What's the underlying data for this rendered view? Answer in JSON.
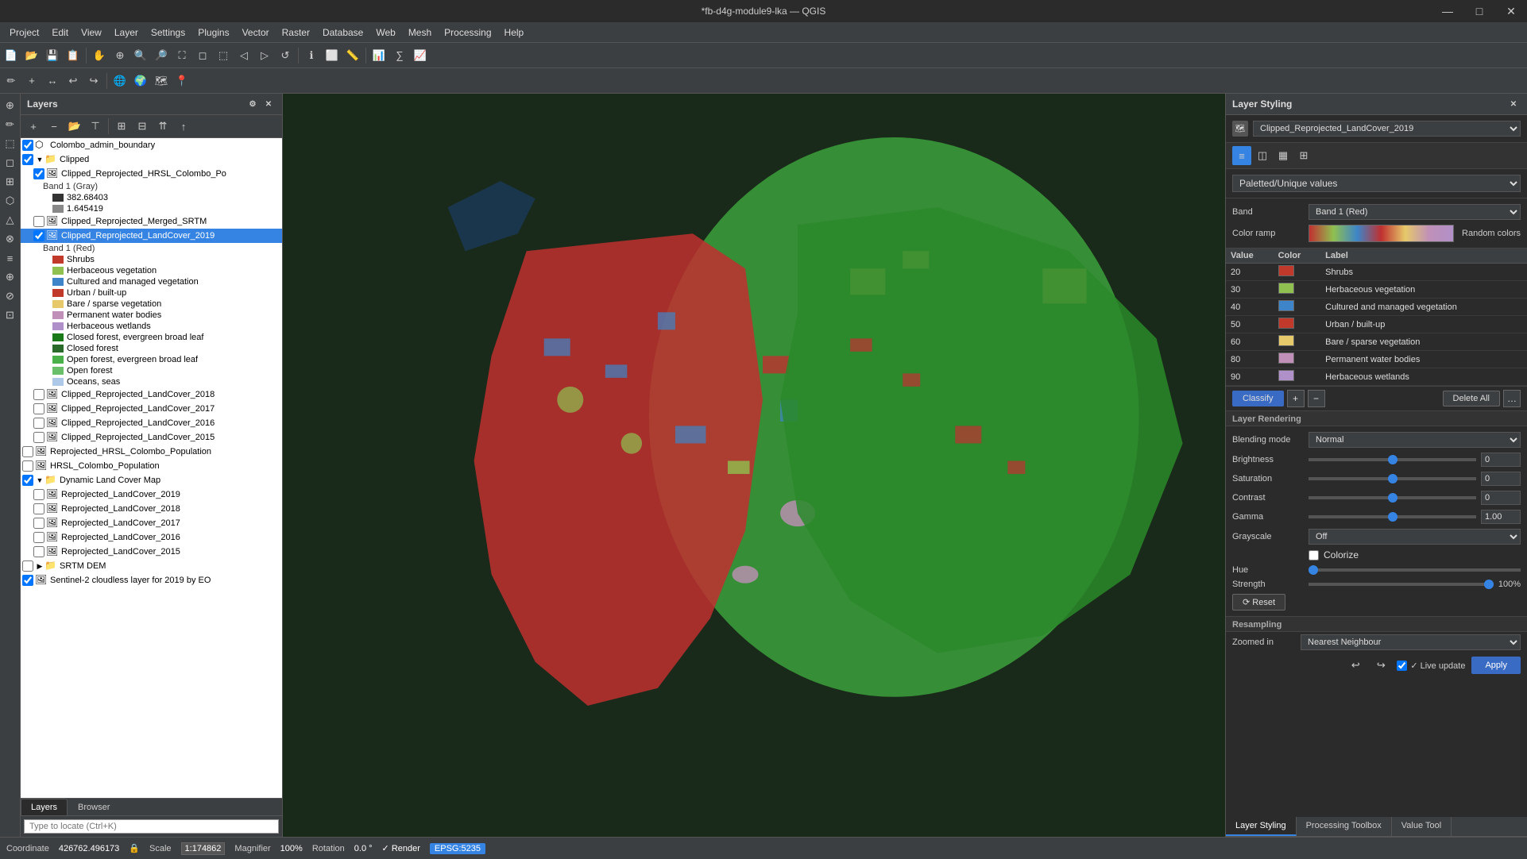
{
  "titlebar": {
    "title": "*fb-d4g-module9-lka — QGIS",
    "minimize": "—",
    "maximize": "□",
    "close": "✕"
  },
  "menubar": {
    "items": [
      "Project",
      "Edit",
      "View",
      "Layer",
      "Settings",
      "Plugins",
      "Vector",
      "Raster",
      "Database",
      "Web",
      "Mesh",
      "Processing",
      "Help"
    ]
  },
  "layers_panel": {
    "title": "Layers",
    "items": [
      {
        "id": "colombo_admin",
        "label": "Colombo_admin_boundary",
        "checked": true,
        "indent": 0,
        "type": "vector",
        "expanded": false
      },
      {
        "id": "clipped",
        "label": "Clipped",
        "checked": true,
        "indent": 0,
        "type": "group",
        "expanded": true
      },
      {
        "id": "hrsl_colombo",
        "label": "Clipped_Reprojected_HRSL_Colombo_Po",
        "checked": true,
        "indent": 1,
        "type": "raster",
        "expanded": true
      },
      {
        "id": "band1_gray_label",
        "label": "Band 1 (Gray)",
        "checked": false,
        "indent": 2,
        "type": "label"
      },
      {
        "id": "band1_val1",
        "label": "382.68403",
        "checked": false,
        "indent": 3,
        "type": "gradient_top"
      },
      {
        "id": "band1_val2",
        "label": "1.645419",
        "checked": false,
        "indent": 3,
        "type": "gradient_bottom"
      },
      {
        "id": "merged_srtm",
        "label": "Clipped_Reprojected_Merged_SRTM",
        "checked": false,
        "indent": 1,
        "type": "raster"
      },
      {
        "id": "landcover_2019",
        "label": "Clipped_Reprojected_LandCover_2019",
        "checked": true,
        "indent": 1,
        "type": "raster",
        "selected": true,
        "expanded": true
      },
      {
        "id": "band1_red_label",
        "label": "Band 1 (Red)",
        "checked": false,
        "indent": 2,
        "type": "label"
      },
      {
        "id": "lc_shrubs",
        "label": "Shrubs",
        "checked": false,
        "indent": 3,
        "type": "legend",
        "color": "#c0392b"
      },
      {
        "id": "lc_herbaceous",
        "label": "Herbaceous vegetation",
        "checked": false,
        "indent": 3,
        "type": "legend",
        "color": "#90c050"
      },
      {
        "id": "lc_cultured",
        "label": "Cultured and managed vegetation",
        "checked": false,
        "indent": 3,
        "type": "legend",
        "color": "#3d85c8"
      },
      {
        "id": "lc_urban",
        "label": "Urban / built-up",
        "checked": false,
        "indent": 3,
        "type": "legend",
        "color": "#c0392b"
      },
      {
        "id": "lc_bare",
        "label": "Bare / sparse vegetation",
        "checked": false,
        "indent": 3,
        "type": "legend",
        "color": "#e6c96a"
      },
      {
        "id": "lc_water",
        "label": "Permanent water bodies",
        "checked": false,
        "indent": 3,
        "type": "legend",
        "color": "#c090b8"
      },
      {
        "id": "lc_wetlands",
        "label": "Herbaceous wetlands",
        "checked": false,
        "indent": 3,
        "type": "legend",
        "color": "#b090c8"
      },
      {
        "id": "lc_closed_ev",
        "label": "Closed forest, evergreen broad leaf",
        "checked": false,
        "indent": 3,
        "type": "legend",
        "color": "#1a7a1a"
      },
      {
        "id": "lc_closed",
        "label": "Closed forest",
        "checked": false,
        "indent": 3,
        "type": "legend",
        "color": "#2a6a2a"
      },
      {
        "id": "lc_open_ev",
        "label": "Open forest, evergreen broad leaf",
        "checked": false,
        "indent": 3,
        "type": "legend",
        "color": "#4ab04a"
      },
      {
        "id": "lc_open",
        "label": "Open forest",
        "checked": false,
        "indent": 3,
        "type": "legend",
        "color": "#6ac06a"
      },
      {
        "id": "lc_oceans",
        "label": "Oceans, seas",
        "checked": false,
        "indent": 3,
        "type": "legend",
        "color": "#aec8e8"
      },
      {
        "id": "landcover_2018",
        "label": "Clipped_Reprojected_LandCover_2018",
        "checked": false,
        "indent": 1,
        "type": "raster"
      },
      {
        "id": "landcover_2017",
        "label": "Clipped_Reprojected_LandCover_2017",
        "checked": false,
        "indent": 1,
        "type": "raster"
      },
      {
        "id": "landcover_2016",
        "label": "Clipped_Reprojected_LandCover_2016",
        "checked": false,
        "indent": 1,
        "type": "raster"
      },
      {
        "id": "landcover_2015",
        "label": "Clipped_Reprojected_LandCover_2015",
        "checked": false,
        "indent": 1,
        "type": "raster"
      },
      {
        "id": "repro_hrsl_pop",
        "label": "Reprojected_HRSL_Colombo_Population",
        "checked": false,
        "indent": 0,
        "type": "raster"
      },
      {
        "id": "hrsl_pop",
        "label": "HRSL_Colombo_Population",
        "checked": false,
        "indent": 0,
        "type": "raster"
      },
      {
        "id": "dynamic_land",
        "label": "Dynamic Land Cover Map",
        "checked": true,
        "indent": 0,
        "type": "group",
        "expanded": true
      },
      {
        "id": "repr_lc_2019",
        "label": "Reprojected_LandCover_2019",
        "checked": false,
        "indent": 1,
        "type": "raster"
      },
      {
        "id": "repr_lc_2018",
        "label": "Reprojected_LandCover_2018",
        "checked": false,
        "indent": 1,
        "type": "raster"
      },
      {
        "id": "repr_lc_2017",
        "label": "Reprojected_LandCover_2017",
        "checked": false,
        "indent": 1,
        "type": "raster"
      },
      {
        "id": "repr_lc_2016",
        "label": "Reprojected_LandCover_2016",
        "checked": false,
        "indent": 1,
        "type": "raster"
      },
      {
        "id": "repr_lc_2015",
        "label": "Reprojected_LandCover_2015",
        "checked": false,
        "indent": 1,
        "type": "raster"
      },
      {
        "id": "srtm_dem",
        "label": "SRTM DEM",
        "checked": false,
        "indent": 0,
        "type": "group"
      },
      {
        "id": "sentinel2",
        "label": "Sentinel-2 cloudless layer for 2019 by EO",
        "checked": true,
        "indent": 0,
        "type": "raster"
      }
    ]
  },
  "styling_panel": {
    "title": "Layer Styling",
    "layer_name": "Clipped_Reprojected_LandCover_2019",
    "renderer": "Paletted/Unique values",
    "band": "Band 1 (Red)",
    "color_ramp": "Random colors",
    "table_headers": [
      "Value",
      "Color",
      "Label"
    ],
    "table_rows": [
      {
        "value": "20",
        "color": "#c0392b",
        "label": "Shrubs"
      },
      {
        "value": "30",
        "color": "#90c050",
        "label": "Herbaceous vegetation"
      },
      {
        "value": "40",
        "color": "#3d85c8",
        "label": "Cultured and managed vegetation"
      },
      {
        "value": "50",
        "color": "#c0392b",
        "label": "Urban / built-up"
      },
      {
        "value": "60",
        "color": "#e6c96a",
        "label": "Bare / sparse vegetation"
      },
      {
        "value": "80",
        "color": "#c090b8",
        "label": "Permanent water bodies"
      },
      {
        "value": "90",
        "color": "#b090c8",
        "label": "Herbaceous wetlands"
      }
    ],
    "classify_btn": "Classify",
    "delete_all_btn": "Delete All",
    "layer_rendering": {
      "title": "Layer Rendering",
      "blending_mode_label": "Blending mode",
      "blending_mode_value": "Normal",
      "brightness_label": "Brightness",
      "brightness_value": "0",
      "saturation_label": "Saturation",
      "saturation_value": "0",
      "contrast_label": "Contrast",
      "contrast_value": "0",
      "gamma_label": "Gamma",
      "gamma_value": "1.00",
      "grayscale_label": "Grayscale",
      "grayscale_value": "Off",
      "colorize_label": "Colorize",
      "hue_label": "Hue",
      "strength_label": "Strength",
      "strength_value": "100%",
      "reset_btn": "⟳ Reset"
    },
    "resampling": {
      "title": "Resampling",
      "zoomed_in_label": "Zoomed in",
      "zoomed_in_value": "Nearest Neighbour",
      "refresh_icon": "↺",
      "live_update_label": "✓ Live update",
      "apply_btn": "Apply"
    },
    "bottom_tabs": [
      "Layer Styling",
      "Processing Toolbox",
      "Value Tool"
    ]
  },
  "bottom_bar": {
    "coordinate_label": "Coordinate",
    "coordinate_value": "426762.496173",
    "scale_label": "Scale",
    "scale_value": "1:174862",
    "magnifier_label": "Magnifier",
    "magnifier_value": "100%",
    "rotation_label": "Rotation",
    "rotation_value": "0.0 °",
    "render_label": "✓ Render",
    "epsg_value": "EPSG:5235"
  },
  "bottom_tabs": {
    "layers": "Layers",
    "browser": "Browser"
  },
  "search": {
    "placeholder": "Type to locate (Ctrl+K)"
  }
}
